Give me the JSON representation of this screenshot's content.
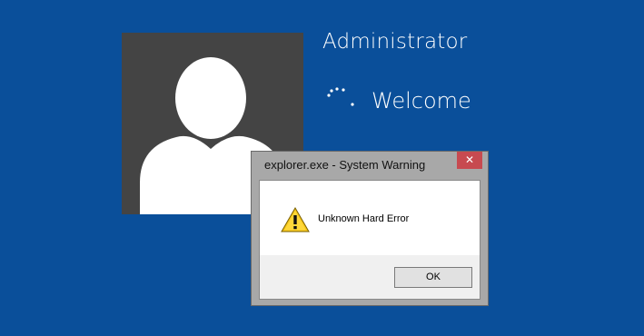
{
  "login": {
    "username": "Administrator",
    "status": "Welcome"
  },
  "dialog": {
    "title": "explorer.exe - System Warning",
    "close_label": "✕",
    "message": "Unknown Hard Error",
    "ok_label": "OK",
    "icon": "warning-icon"
  },
  "colors": {
    "background": "#0a4f9a",
    "avatar_bg": "#444444",
    "close_button": "#c74a50"
  }
}
